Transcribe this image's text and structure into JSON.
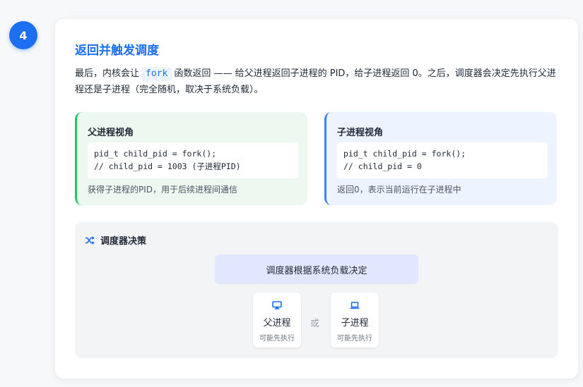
{
  "step": {
    "number": "4"
  },
  "section": {
    "title": "返回并触发调度",
    "desc_before": "最后，内核会让",
    "desc_code": "fork",
    "desc_after": "函数返回 —— 给父进程返回子进程的 PID，给子进程返回 0。之后，调度器会决定先执行父进程还是子进程（完全随机，取决于系统负载）。"
  },
  "parent_view": {
    "title": "父进程视角",
    "code": "pid_t child_pid = fork();\n// child_pid = 1003 (子进程PID)",
    "note": "获得子进程的PID，用于后续进程间通信"
  },
  "child_view": {
    "title": "子进程视角",
    "code": "pid_t child_pid = fork();\n// child_pid = 0",
    "note": "返回0，表示当前运行在子进程中"
  },
  "scheduler": {
    "title": "调度器决策",
    "icon": "shuffle-icon",
    "decision": "调度器根据系统负载决定",
    "options": [
      {
        "icon": "desktop-icon",
        "label": "父进程",
        "sub": "可能先执行"
      },
      {
        "icon": "laptop-icon",
        "label": "子进程",
        "sub": "可能先执行"
      }
    ],
    "or": "或"
  },
  "colors": {
    "accent": "#1d6ff2",
    "parent_border": "#22c55e",
    "child_border": "#3b82f6"
  }
}
